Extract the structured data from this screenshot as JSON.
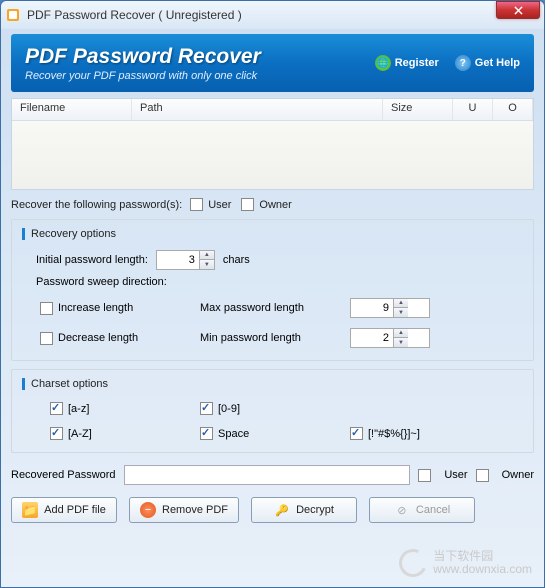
{
  "titlebar": {
    "title": "PDF Password Recover ( Unregistered )"
  },
  "banner": {
    "title": "PDF Password Recover",
    "subtitle": "Recover your PDF password with only one click",
    "register": "Register",
    "help": "Get Help"
  },
  "table": {
    "headers": {
      "filename": "Filename",
      "path": "Path",
      "size": "Size",
      "u": "U",
      "o": "O"
    }
  },
  "recover_row": {
    "label": "Recover the following password(s):",
    "user": "User",
    "owner": "Owner"
  },
  "recovery": {
    "title": "Recovery options",
    "initial_label": "Initial password length:",
    "initial_value": "3",
    "chars": "chars",
    "sweep_label": "Password sweep direction:",
    "increase": "Increase length",
    "decrease": "Decrease length",
    "max_label": "Max password length",
    "max_value": "9",
    "min_label": "Min password length",
    "min_value": "2"
  },
  "charset": {
    "title": "Charset options",
    "az": "[a-z]",
    "AZ": "[A-Z]",
    "digits": "[0-9]",
    "space": "Space",
    "special": "[!\"#$%{}]~]"
  },
  "recovered": {
    "label": "Recovered Password",
    "value": "",
    "user": "User",
    "owner": "Owner"
  },
  "buttons": {
    "add": "Add PDF file",
    "remove": "Remove PDF",
    "decrypt": "Decrypt",
    "cancel": "Cancel"
  },
  "watermark": {
    "name": "当下软件园",
    "url": "www.downxia.com"
  }
}
